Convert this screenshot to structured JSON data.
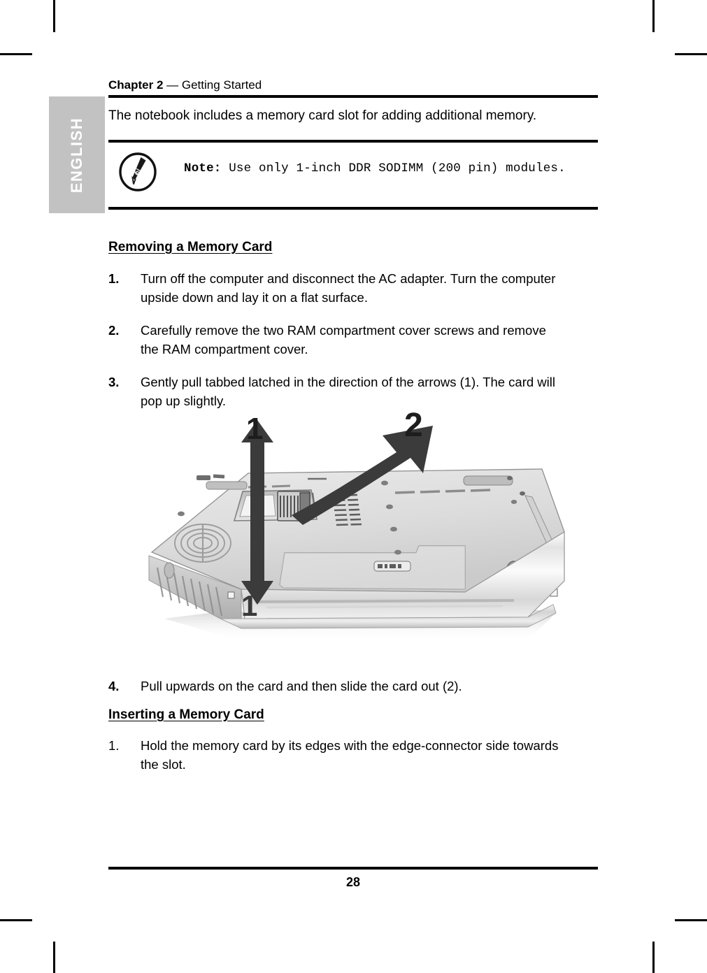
{
  "document": {
    "header": {
      "chapter_label": "Chapter 2",
      "dash": " — ",
      "chapter_title": "Getting Started"
    },
    "language_tab": {
      "label": "ENGLISH",
      "background_color": "#c2c2c2",
      "text_color": "#ffffff"
    },
    "intro_paragraph": "The notebook includes a memory card slot for adding additional memory.",
    "note": {
      "icon_name": "pen-note-icon",
      "lead": "Note:",
      "text": " Use only 1-inch DDR SODIMM (200 pin) modules."
    },
    "sections": [
      {
        "heading": "Removing a Memory Card",
        "steps": [
          {
            "number": "1.",
            "bold_number": true,
            "text": "Turn off the computer and disconnect the AC adapter. Turn the computer upside down and lay it on a flat surface."
          },
          {
            "number": "2.",
            "bold_number": true,
            "text": "Carefully remove the two RAM compartment cover screws and remove the RAM compartment cover."
          },
          {
            "number": "3.",
            "bold_number": true,
            "text": "Gently pull tabbed latched in the direction of the arrows (1).  The card will pop up slightly."
          },
          {
            "number": "4.",
            "bold_number": true,
            "text": "Pull upwards on the card and then slide the card out (2)."
          }
        ]
      },
      {
        "heading": "Inserting a Memory Card",
        "steps": [
          {
            "number": "1.",
            "bold_number": false,
            "text": "Hold the memory card by its edges with the edge-connector side towards the slot."
          }
        ]
      }
    ],
    "figure": {
      "name": "notebook-underside-memory-slot-diagram",
      "description": "Underside view of a notebook computer showing the memory card slot with directional arrows",
      "callouts": [
        {
          "label": "1",
          "meaning": "pull latches / card pops up",
          "position": "top-center"
        },
        {
          "label": "2",
          "meaning": "slide card out",
          "position": "top-right"
        },
        {
          "label": "1",
          "meaning": "pull latches / card pops up",
          "position": "bottom-center"
        }
      ]
    },
    "footer": {
      "page_number": "28"
    }
  }
}
